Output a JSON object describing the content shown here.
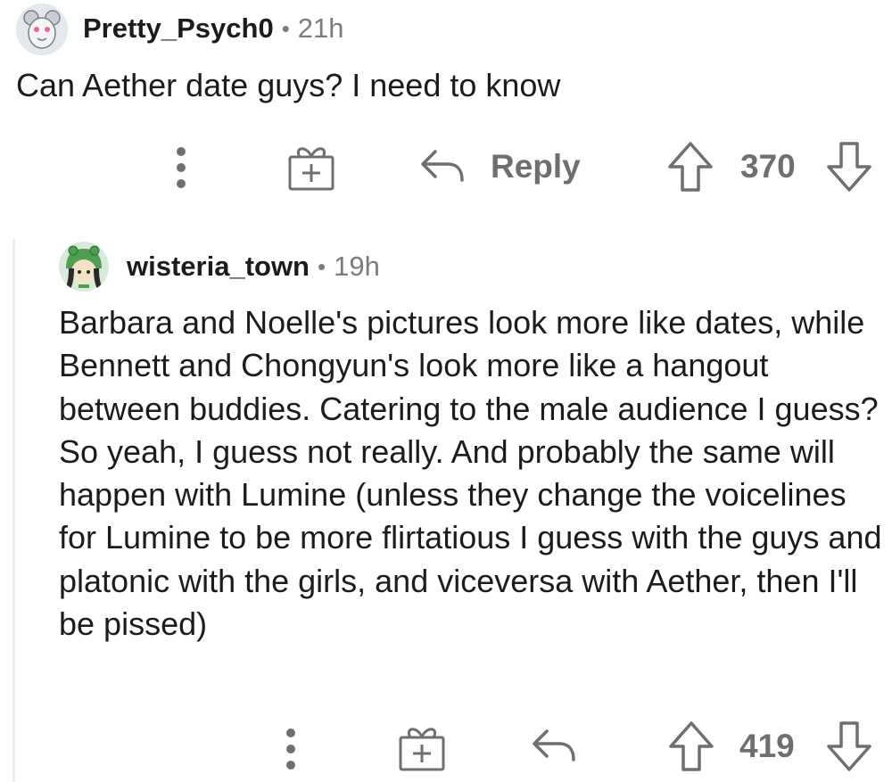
{
  "comments": [
    {
      "username": "Pretty_Psych0",
      "time_sep": "•",
      "time": "21h",
      "body": "Can Aether date guys? I need to know",
      "actions": {
        "more_icon": "more-vertical-icon",
        "award_icon": "gift-award-icon",
        "reply_label": "Reply",
        "score": "370"
      }
    },
    {
      "username": "wisteria_town",
      "time_sep": "•",
      "time": "19h",
      "body": "Barbara and Noelle's pictures look more like dates, while Bennett and Chongyun's look more like a hangout between buddies. Catering to the male audience I guess? So yeah, I guess not really. And probably the same will happen with Lumine (unless they change the voicelines for Lumine to be more flirtatious I guess with the guys and platonic with the girls, and viceversa with Aether, then I'll be pissed)",
      "actions": {
        "more_icon": "more-vertical-icon",
        "award_icon": "gift-award-icon",
        "score": "419"
      }
    }
  ],
  "colors": {
    "text": "#1c1c1c",
    "muted": "#6f6f6f",
    "thread_line": "#ececec"
  }
}
